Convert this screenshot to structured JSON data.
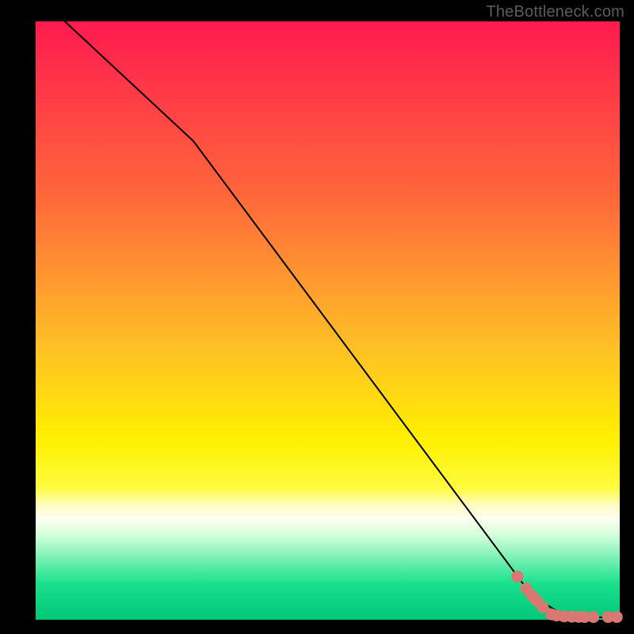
{
  "attribution": "TheBottleneck.com",
  "plot": {
    "margin_left": 45,
    "margin_right": 18,
    "margin_top": 27,
    "margin_bottom": 18,
    "inner_w": 737,
    "inner_h": 755
  },
  "gradient": {
    "stops": [
      {
        "offset": 0.0,
        "color": "#ff1a4f"
      },
      {
        "offset": 0.3,
        "color": "#ff6a3a"
      },
      {
        "offset": 0.55,
        "color": "#ffc225"
      },
      {
        "offset": 0.7,
        "color": "#fff000"
      },
      {
        "offset": 0.78,
        "color": "#fffc40"
      },
      {
        "offset": 0.81,
        "color": "#fffcc8"
      },
      {
        "offset": 0.83,
        "color": "#fffff0"
      },
      {
        "offset": 0.86,
        "color": "#d0ffd8"
      },
      {
        "offset": 0.94,
        "color": "#18e08c"
      },
      {
        "offset": 1.0,
        "color": "#00c878"
      }
    ]
  },
  "chart_data": {
    "type": "line",
    "title": "",
    "xlabel": "",
    "ylabel": "",
    "xlim": [
      0,
      100
    ],
    "ylim": [
      0,
      100
    ],
    "series": [
      {
        "name": "curve",
        "style": "line",
        "color": "#000000",
        "x": [
          5,
          27,
          85,
          90,
          95,
          100
        ],
        "y": [
          100,
          80,
          4,
          1,
          0.4,
          0.4
        ]
      },
      {
        "name": "points",
        "style": "scatter",
        "color": "#d97772",
        "x": [
          82.5,
          84.0,
          85.0,
          85.8,
          86.8,
          88.3,
          89.2,
          90.5,
          91.8,
          93.0,
          94.0,
          95.5,
          98.0,
          99.5
        ],
        "y": [
          7.2,
          5.2,
          4.0,
          3.2,
          2.1,
          0.9,
          0.7,
          0.55,
          0.5,
          0.48,
          0.45,
          0.45,
          0.45,
          0.45
        ]
      }
    ]
  }
}
